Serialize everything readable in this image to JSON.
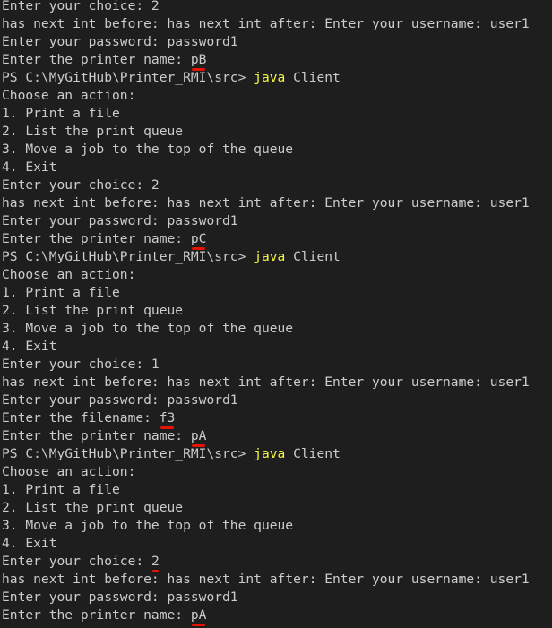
{
  "terminal": {
    "lines": [
      {
        "segments": [
          {
            "text": "Enter your choice: 2"
          }
        ]
      },
      {
        "segments": [
          {
            "text": "has next int before: has next int after: Enter your username: user1"
          }
        ]
      },
      {
        "segments": [
          {
            "text": "Enter your password: password1"
          }
        ]
      },
      {
        "segments": [
          {
            "text": "Enter the printer name: "
          },
          {
            "text": "pB",
            "mark": true
          }
        ]
      },
      {
        "segments": [
          {
            "text": "PS C:\\MyGitHub\\Printer_RMI\\src> "
          },
          {
            "text": "java",
            "cmd": true
          },
          {
            "text": " Client"
          }
        ]
      },
      {
        "segments": [
          {
            "text": "Choose an action:"
          }
        ]
      },
      {
        "segments": [
          {
            "text": "1. Print a file"
          }
        ]
      },
      {
        "segments": [
          {
            "text": "2. List the print queue"
          }
        ]
      },
      {
        "segments": [
          {
            "text": "3. Move a job to the top of the queue"
          }
        ]
      },
      {
        "segments": [
          {
            "text": "4. Exit"
          }
        ]
      },
      {
        "segments": [
          {
            "text": "Enter your choice: 2"
          }
        ]
      },
      {
        "segments": [
          {
            "text": "has next int before: has next int after: Enter your username: user1"
          }
        ]
      },
      {
        "segments": [
          {
            "text": "Enter your password: password1"
          }
        ]
      },
      {
        "segments": [
          {
            "text": "Enter the printer name: "
          },
          {
            "text": "pC",
            "mark": true
          }
        ]
      },
      {
        "segments": [
          {
            "text": "PS C:\\MyGitHub\\Printer_RMI\\src> "
          },
          {
            "text": "java",
            "cmd": true
          },
          {
            "text": " Client"
          }
        ]
      },
      {
        "segments": [
          {
            "text": "Choose an action:"
          }
        ]
      },
      {
        "segments": [
          {
            "text": "1. Print a file"
          }
        ]
      },
      {
        "segments": [
          {
            "text": "2. List the print queue"
          }
        ]
      },
      {
        "segments": [
          {
            "text": "3. Move a job to the top of the queue"
          }
        ]
      },
      {
        "segments": [
          {
            "text": "4. Exit"
          }
        ]
      },
      {
        "segments": [
          {
            "text": "Enter your choice: 1"
          }
        ]
      },
      {
        "segments": [
          {
            "text": "has next int before: has next int after: Enter your username: user1"
          }
        ]
      },
      {
        "segments": [
          {
            "text": "Enter your password: password1"
          }
        ]
      },
      {
        "segments": [
          {
            "text": "Enter the filename: "
          },
          {
            "text": "f3",
            "mark": true
          }
        ]
      },
      {
        "segments": [
          {
            "text": "Enter the printer name: "
          },
          {
            "text": "pA",
            "mark": true
          }
        ]
      },
      {
        "segments": [
          {
            "text": "PS C:\\MyGitHub\\Printer_RMI\\src> "
          },
          {
            "text": "java",
            "cmd": true
          },
          {
            "text": " Client"
          }
        ]
      },
      {
        "segments": [
          {
            "text": "Choose an action:"
          }
        ]
      },
      {
        "segments": [
          {
            "text": "1. Print a file"
          }
        ]
      },
      {
        "segments": [
          {
            "text": "2. List the print queue"
          }
        ]
      },
      {
        "segments": [
          {
            "text": "3. Move a job to the top of the queue"
          }
        ]
      },
      {
        "segments": [
          {
            "text": "4. Exit"
          }
        ]
      },
      {
        "segments": [
          {
            "text": "Enter your choice: "
          },
          {
            "text": "2",
            "mark": true
          }
        ]
      },
      {
        "segments": [
          {
            "text": "has next int before: has next int after: Enter your username: user1"
          }
        ]
      },
      {
        "segments": [
          {
            "text": "Enter your password: password1"
          }
        ]
      },
      {
        "segments": [
          {
            "text": "Enter the printer name: "
          },
          {
            "text": "pA",
            "mark": true
          }
        ]
      }
    ]
  },
  "colors": {
    "background": "#1e1e1e",
    "foreground": "#cccccc",
    "command": "#f5f543",
    "annotation": "#e51400"
  }
}
